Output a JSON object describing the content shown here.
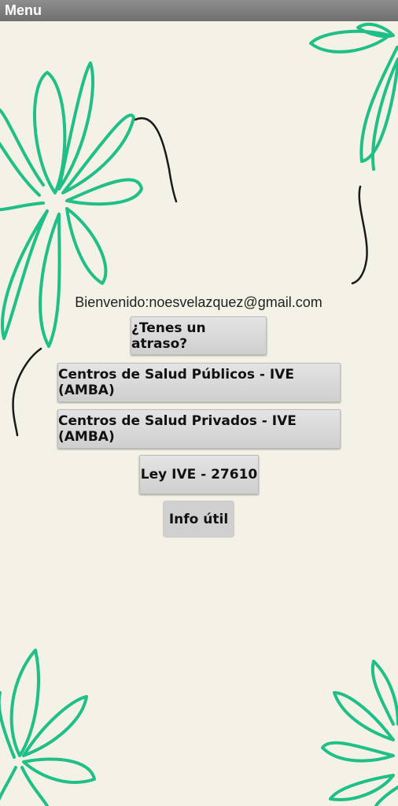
{
  "titlebar": {
    "title": "Menu"
  },
  "welcome": {
    "text": "Bienvenido:noesvelazquez@gmail.com"
  },
  "buttons": {
    "atraso": "¿Tenes un atraso?",
    "publicos": "Centros de Salud Públicos - IVE (AMBA)",
    "privados": "Centros de Salud Privados - IVE (AMBA)",
    "ley": "Ley IVE - 27610",
    "info": "Info útil"
  },
  "colors": {
    "background": "#f4f2e6",
    "flower": "#1fbf87",
    "stroke": "#1a1a1a",
    "titlebar": "#7f7f7f"
  },
  "icons": [
    "flower-decoration-icon",
    "swirl-line-icon"
  ]
}
